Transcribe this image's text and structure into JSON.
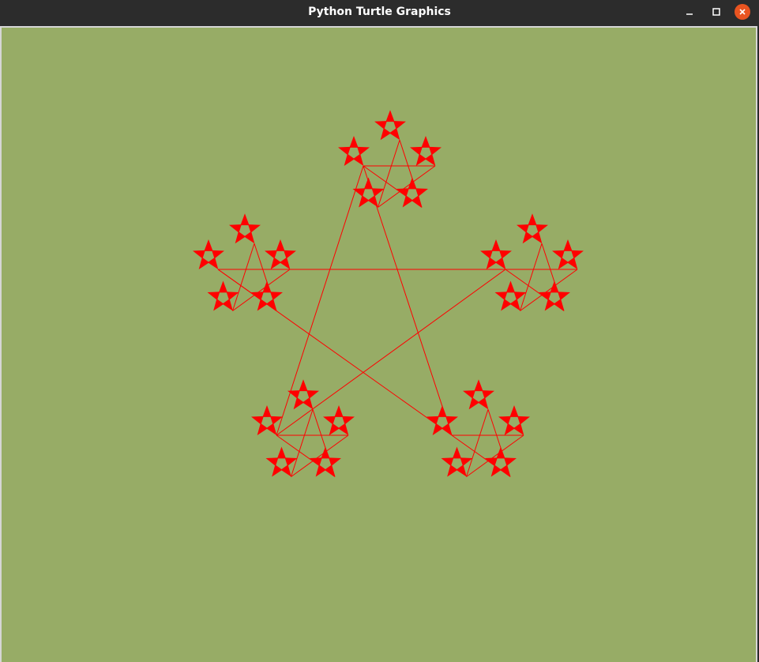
{
  "window": {
    "title": "Python Turtle Graphics",
    "controls": {
      "minimize_icon": "minimize-icon",
      "maximize_icon": "maximize-icon",
      "close_icon": "close-icon"
    }
  },
  "canvas": {
    "background_color": "#97ac66",
    "pen_color": "#ff0000",
    "drawing": "pentagram fractal with star markers"
  },
  "colors": {
    "titlebar": "#2c2c2c",
    "close_button": "#e95420",
    "title_text": "#ffffff"
  }
}
